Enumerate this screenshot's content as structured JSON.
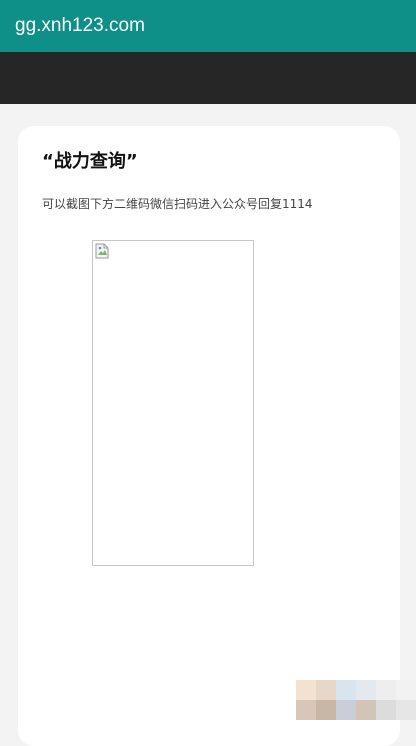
{
  "browser": {
    "url": "gg.xnh123.com"
  },
  "card": {
    "title": "“战力查询”",
    "description": "可以截图下方二维码微信扫码进入公众号回复1114"
  },
  "image": {
    "icon": "broken-image-icon"
  },
  "colors": {
    "url_bar": "#0e8f87",
    "dark_bar": "#262626",
    "page_bg": "#f3f3f3",
    "card_bg": "#ffffff"
  },
  "mosaic_colors": [
    "#f4e1d0",
    "#e7d7c9",
    "#d8e4ee",
    "#e3e9ef",
    "#eeeeee",
    "#f2f2f2",
    "#d8c7b8",
    "#c9b6a5",
    "#c8cfd8",
    "#d2c4b6",
    "#dcdcdc",
    "#e6e6e6"
  ]
}
